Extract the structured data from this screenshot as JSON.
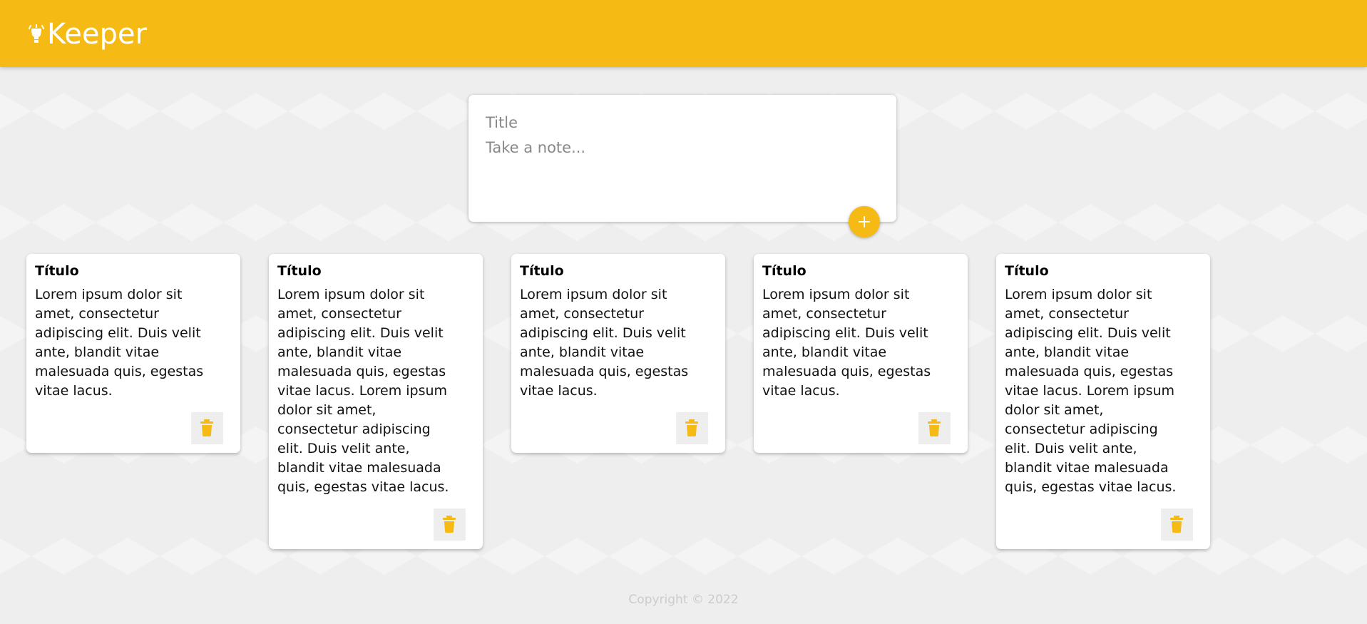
{
  "app": {
    "title": "Keeper",
    "brand_color": "#f5ba13",
    "brand_icon": "lightbulb-icon"
  },
  "composer": {
    "title_placeholder": "Title",
    "content_placeholder": "Take a note...",
    "add_icon": "plus-icon"
  },
  "notes": [
    {
      "title": "Título",
      "content": "Lorem ipsum dolor sit\namet, consectetur\nadipiscing elit. Duis velit\nante, blandit vitae\nmalesuada quis, egestas\nvitae lacus."
    },
    {
      "title": "Título",
      "content": "Lorem ipsum dolor sit\namet, consectetur\nadipiscing elit. Duis velit\nante, blandit vitae\nmalesuada quis, egestas\nvitae lacus. Lorem ipsum\ndolor sit amet,\nconsectetur adipiscing\nelit. Duis velit ante,\nblandit vitae malesuada\nquis, egestas vitae lacus."
    },
    {
      "title": "Título",
      "content": "Lorem ipsum dolor sit\namet, consectetur\nadipiscing elit. Duis velit\nante, blandit vitae\nmalesuada quis, egestas\nvitae lacus."
    },
    {
      "title": "Título",
      "content": "Lorem ipsum dolor sit\namet, consectetur\nadipiscing elit. Duis velit\nante, blandit vitae\nmalesuada quis, egestas\nvitae lacus."
    },
    {
      "title": "Título",
      "content": "Lorem ipsum dolor sit\namet, consectetur\nadipiscing elit. Duis velit\nante, blandit vitae\nmalesuada quis, egestas\nvitae lacus. Lorem ipsum\ndolor sit amet,\nconsectetur adipiscing\nelit. Duis velit ante,\nblandit vitae malesuada\nquis, egestas vitae lacus."
    }
  ],
  "note_delete_icon": "trash-icon",
  "footer": {
    "copyright": "Copyright © 2022"
  }
}
